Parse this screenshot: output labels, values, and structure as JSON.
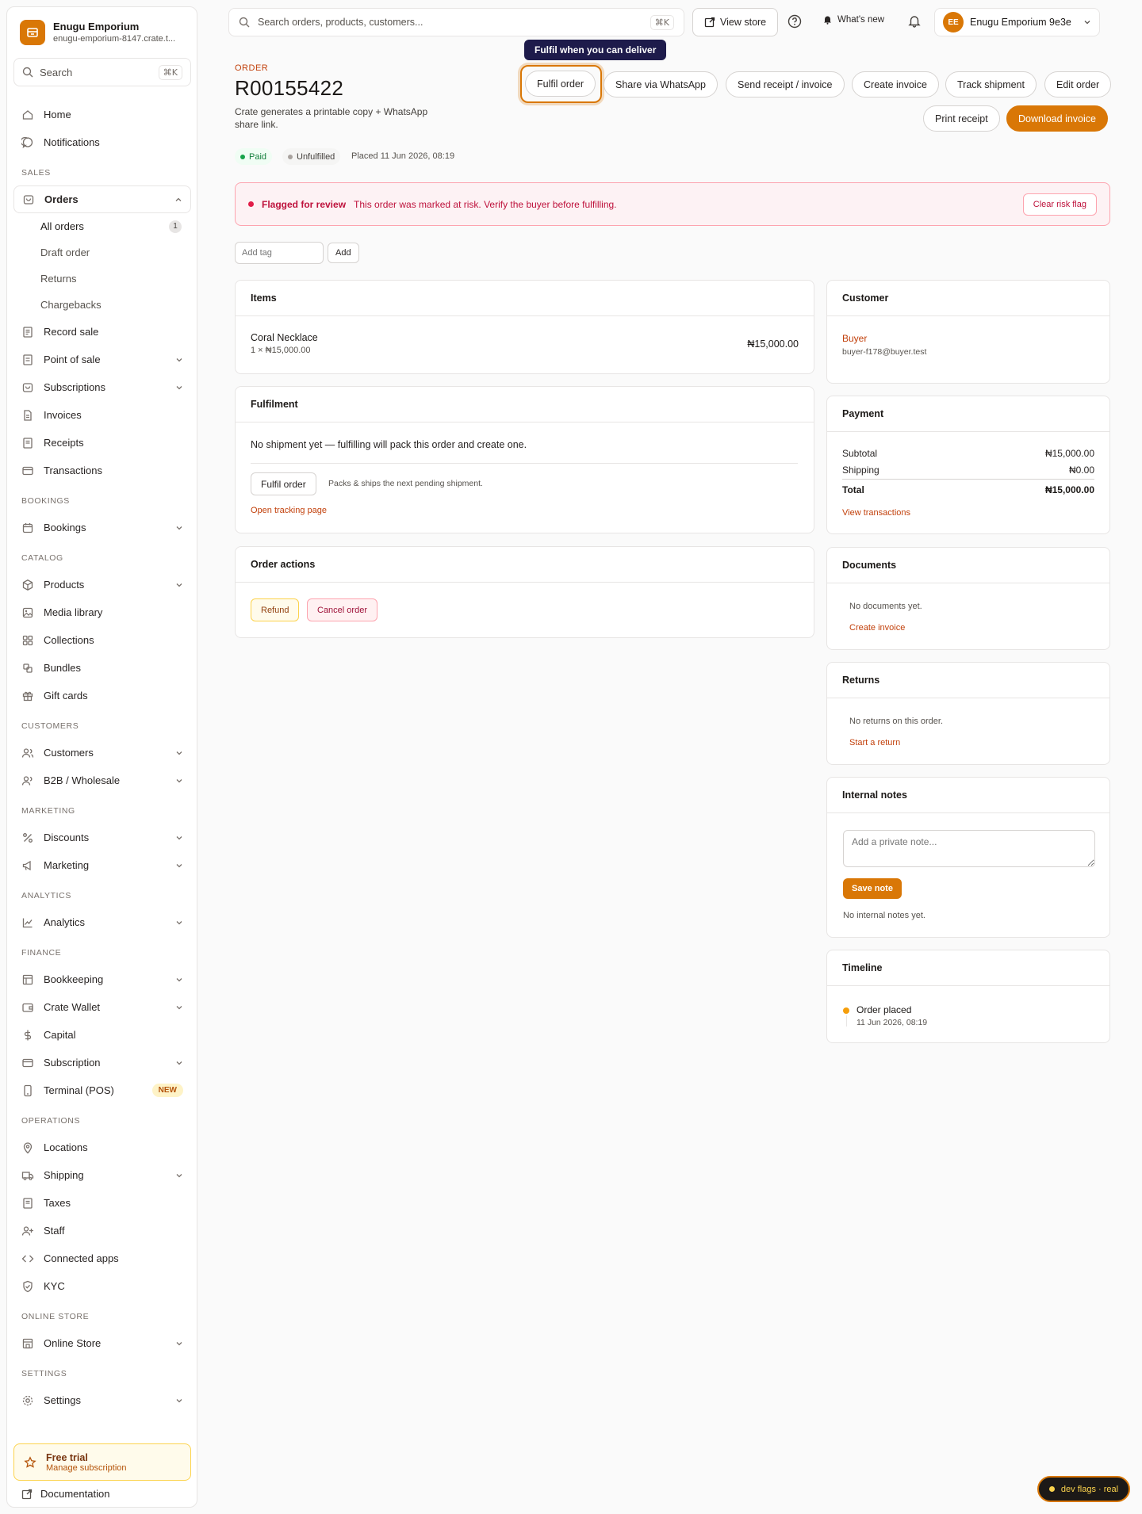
{
  "brand": {
    "name": "Enugu Emporium",
    "subdomain": "enugu-emporium-8147.crate.t..."
  },
  "sidebar": {
    "search_placeholder": "Search",
    "search_shortcut": "⌘K",
    "home": "Home",
    "notifications": "Notifications",
    "sections": {
      "sales": "SALES",
      "bookings": "BOOKINGS",
      "catalog": "CATALOG",
      "customers": "CUSTOMERS",
      "marketing": "MARKETING",
      "analytics": "ANALYTICS",
      "finance": "FINANCE",
      "operations": "OPERATIONS",
      "online_store": "ONLINE STORE",
      "settings": "SETTINGS"
    },
    "orders": "Orders",
    "orders_sub": {
      "all": "All orders",
      "all_count": "1",
      "draft": "Draft order",
      "returns": "Returns",
      "chargebacks": "Chargebacks"
    },
    "record_sale": "Record sale",
    "point_of_sale": "Point of sale",
    "subscriptions": "Subscriptions",
    "invoices": "Invoices",
    "receipts": "Receipts",
    "transactions": "Transactions",
    "bookings": "Bookings",
    "products": "Products",
    "media_library": "Media library",
    "collections": "Collections",
    "bundles": "Bundles",
    "gift_cards": "Gift cards",
    "customers": "Customers",
    "b2b": "B2B / Wholesale",
    "discounts": "Discounts",
    "marketing": "Marketing",
    "analytics": "Analytics",
    "bookkeeping": "Bookkeeping",
    "crate_wallet": "Crate Wallet",
    "capital": "Capital",
    "subscription": "Subscription",
    "terminal": "Terminal (POS)",
    "terminal_badge": "NEW",
    "locations": "Locations",
    "shipping": "Shipping",
    "taxes": "Taxes",
    "staff": "Staff",
    "connected_apps": "Connected apps",
    "kyc": "KYC",
    "online_store": "Online Store",
    "settings": "Settings",
    "trial_title": "Free trial",
    "trial_sub": "Manage subscription",
    "documentation": "Documentation"
  },
  "topbar": {
    "search_placeholder": "Search orders, products, customers...",
    "search_shortcut": "⌘K",
    "view_store": "View store",
    "whats_new": "What's new",
    "account_initials": "EE",
    "account_name": "Enugu Emporium 9e3e"
  },
  "order": {
    "eyebrow": "ORDER",
    "number": "R00155422",
    "description": "Crate generates a printable copy + WhatsApp share link.",
    "status_paid": "Paid",
    "status_fulfillment": "Unfulfilled",
    "placed": "Placed 11 Jun 2026, 08:19"
  },
  "actions": {
    "tooltip": "Fulfil when you can deliver",
    "fulfil": "Fulfil order",
    "share_whatsapp": "Share via WhatsApp",
    "send_receipt": "Send receipt / invoice",
    "create_invoice": "Create invoice",
    "track_shipment": "Track shipment",
    "edit_order": "Edit order",
    "print_receipt": "Print receipt",
    "download_invoice": "Download invoice"
  },
  "alert": {
    "title": "Flagged for review",
    "message": "This order was marked at risk. Verify the buyer before fulfilling.",
    "clear": "Clear risk flag"
  },
  "tags": {
    "placeholder": "Add tag",
    "add": "Add"
  },
  "items": {
    "heading": "Items",
    "rows": [
      {
        "name": "Coral Necklace",
        "qty_price": "1 × ₦15,000.00",
        "total": "₦15,000.00"
      }
    ]
  },
  "fulfilment": {
    "heading": "Fulfilment",
    "message": "No shipment yet — fulfilling will pack this order and create one.",
    "button": "Fulfil order",
    "hint": "Packs & ships the next pending shipment.",
    "tracking_link": "Open tracking page"
  },
  "order_actions": {
    "heading": "Order actions",
    "refund": "Refund",
    "cancel": "Cancel order"
  },
  "customer": {
    "heading": "Customer",
    "name": "Buyer",
    "email": "buyer-f178@buyer.test"
  },
  "payment": {
    "heading": "Payment",
    "subtotal_label": "Subtotal",
    "subtotal": "₦15,000.00",
    "shipping_label": "Shipping",
    "shipping": "₦0.00",
    "total_label": "Total",
    "total": "₦15,000.00",
    "link": "View transactions"
  },
  "documents": {
    "heading": "Documents",
    "empty": "No documents yet.",
    "link": "Create invoice"
  },
  "returns": {
    "heading": "Returns",
    "empty": "No returns on this order.",
    "link": "Start a return"
  },
  "notes": {
    "heading": "Internal notes",
    "placeholder": "Add a private note...",
    "save": "Save note",
    "empty": "No internal notes yet."
  },
  "timeline": {
    "heading": "Timeline",
    "events": [
      {
        "title": "Order placed",
        "time": "11 Jun 2026, 08:19"
      }
    ]
  },
  "dev_flags": "dev flags · real",
  "colors": {
    "accent": "#d97706",
    "accent_text": "#c2410c",
    "paid": "#16a34a",
    "danger": "#e11d48",
    "tooltip_bg": "#1e1b4b"
  }
}
